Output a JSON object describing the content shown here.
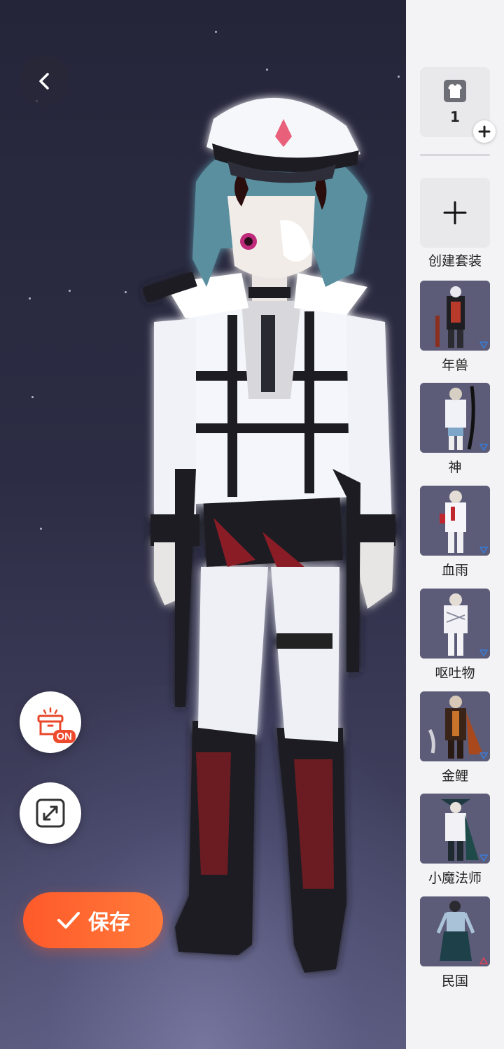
{
  "top_controls": {
    "back_icon": "chevron-left-icon"
  },
  "side_buttons": {
    "wardrobe_toggle": {
      "icon": "wardrobe-box-icon",
      "badge": "ON"
    },
    "fullscreen": {
      "icon": "expand-icon"
    }
  },
  "save_button": {
    "label": "保存",
    "icon": "check-icon"
  },
  "panel": {
    "outfit_count": "1",
    "outfit_count_icon": "shirt-icon",
    "add_icon": "plus-icon",
    "create_label": "创建套装",
    "outfits": [
      {
        "label": "年兽",
        "marker": "down",
        "marker_color": "#3a7bd5"
      },
      {
        "label": "神",
        "marker": "down",
        "marker_color": "#3a7bd5"
      },
      {
        "label": "血雨",
        "marker": "down",
        "marker_color": "#3a7bd5"
      },
      {
        "label": "呕吐物",
        "marker": "down",
        "marker_color": "#3a7bd5"
      },
      {
        "label": "金鲤",
        "marker": "down",
        "marker_color": "#3a7bd5"
      },
      {
        "label": "小魔法师",
        "marker": "down",
        "marker_color": "#3a7bd5"
      },
      {
        "label": "民国",
        "marker": "up",
        "marker_color": "#e0435a"
      }
    ]
  },
  "colors": {
    "accent": "#ff5a2a",
    "badge_red": "#ee4a2e"
  }
}
